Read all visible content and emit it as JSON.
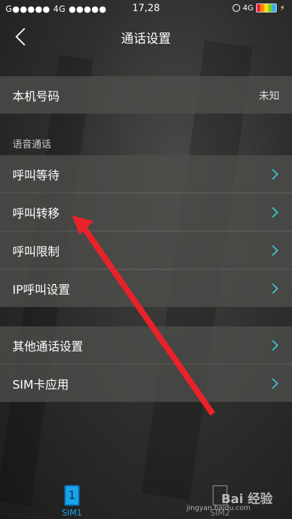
{
  "status_bar": {
    "left": "G●●●●● 4G ●●●●●",
    "time": "17,28",
    "network": "4G"
  },
  "header": {
    "title": "通话设置"
  },
  "phone_number_row": {
    "label": "本机号码",
    "value": "未知"
  },
  "voice_section": {
    "header": "语音通话",
    "items": [
      {
        "label": "呼叫等待"
      },
      {
        "label": "呼叫转移"
      },
      {
        "label": "呼叫限制"
      },
      {
        "label": "IP呼叫设置"
      }
    ]
  },
  "other_section": {
    "items": [
      {
        "label": "其他通话设置"
      },
      {
        "label": "SIM卡应用"
      }
    ]
  },
  "bottom_bar": {
    "sim1": {
      "label": "SIM1",
      "card_text": "1"
    },
    "sim2": {
      "label": "SIM2"
    }
  },
  "watermark": {
    "logo": "Bai 经验",
    "url": "jingyan.baidu.com"
  },
  "colors": {
    "accent": "#3ac2cc",
    "sim_active": "#1aa3e8",
    "annotation_arrow": "#e8222a"
  }
}
